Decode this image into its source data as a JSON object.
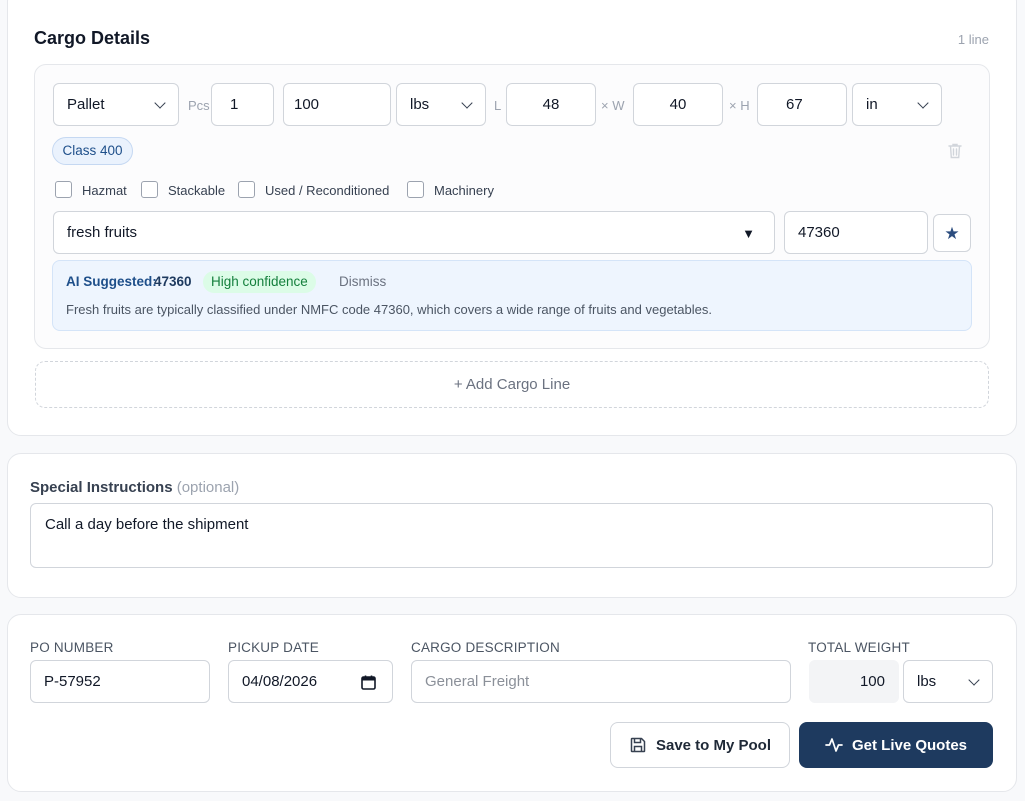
{
  "cargo": {
    "title": "Cargo Details",
    "line_count": "1 line",
    "package_type": "Pallet",
    "pcs_label": "Pcs",
    "pcs_value": "1",
    "weight_value": "100",
    "weight_unit": "lbs",
    "l_label": "L",
    "length": "48",
    "w_label": "× W",
    "width": "40",
    "h_label": "× H",
    "height": "67",
    "dim_unit": "in",
    "class_badge": "Class 400",
    "checkboxes": [
      {
        "label": "Hazmat",
        "checked": false
      },
      {
        "label": "Stackable",
        "checked": false
      },
      {
        "label": "Used / Reconditioned",
        "checked": false
      },
      {
        "label": "Machinery",
        "checked": false
      }
    ],
    "commodity": "fresh fruits",
    "nmfc_code": "47360",
    "ai": {
      "prefix": "AI Suggested:",
      "code": "47360",
      "confidence": "High confidence",
      "dismiss": "Dismiss",
      "explanation": "Fresh fruits are typically classified under NMFC code 47360, which covers a wide range of fruits and vegetables."
    },
    "add_line": "+ Add Cargo Line"
  },
  "instructions": {
    "label": "Special Instructions",
    "optional": "(optional)",
    "value": "Call a day before the shipment"
  },
  "summary": {
    "po_label": "PO NUMBER",
    "po_value": "P-57952",
    "pickup_label": "PICKUP DATE",
    "pickup_value": "04/08/2026",
    "desc_label": "CARGO DESCRIPTION",
    "desc_placeholder": "General Freight",
    "weight_label": "TOTAL WEIGHT",
    "weight_value": "100",
    "weight_unit": "lbs",
    "save_button": "Save to My Pool",
    "quotes_button": "Get Live Quotes"
  },
  "colors": {
    "primary": "#1e3a5f",
    "ai_bg": "#eef5fe",
    "confidence_bg": "#dcfce7",
    "confidence_text": "#15803d",
    "badge_bg": "#eaf2fd"
  }
}
